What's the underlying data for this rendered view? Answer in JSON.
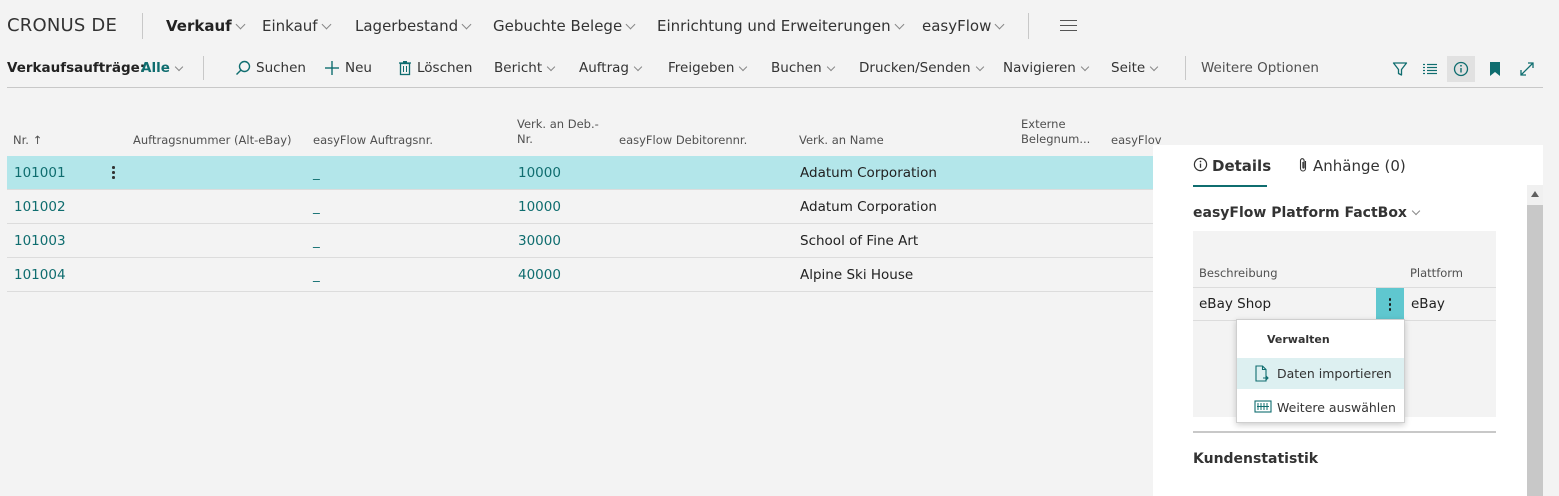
{
  "app": {
    "company": "CRONUS DE",
    "nav": [
      {
        "label": "Verkauf",
        "active": true
      },
      {
        "label": "Einkauf"
      },
      {
        "label": "Lagerbestand"
      },
      {
        "label": "Gebuchte Belege"
      },
      {
        "label": "Einrichtung und Erweiterungen"
      },
      {
        "label": "easyFlow"
      }
    ]
  },
  "actionbar": {
    "title": "Verkaufsaufträge:",
    "filter": "Alle",
    "search": "Suchen",
    "new": "Neu",
    "delete": "Löschen",
    "menus": [
      "Bericht",
      "Auftrag",
      "Freigeben",
      "Buchen",
      "Drucken/Senden",
      "Navigieren",
      "Seite"
    ],
    "more": "Weitere Optionen",
    "right_icons": [
      "filter-icon",
      "list-icon",
      "info-icon",
      "bookmark-icon",
      "expand-icon"
    ]
  },
  "table": {
    "headers": {
      "nr": "Nr. ↑",
      "auftragsnummer": "Auftragsnummer (Alt-eBay)",
      "ef_auftragsnr": "easyFlow Auftragsnr.",
      "deb_nr_1": "Verk. an Deb.-",
      "deb_nr_2": "Nr.",
      "ef_debitor": "easyFlow Debitorennr.",
      "name": "Verk. an Name",
      "ext_1": "Externe",
      "ext_2": "Belegnum...",
      "ef_trunc": "easyFlov"
    },
    "rows": [
      {
        "nr": "101001",
        "ef": "_",
        "deb": "10000",
        "name": "Adatum Corporation",
        "selected": true
      },
      {
        "nr": "101002",
        "ef": "_",
        "deb": "10000",
        "name": "Adatum Corporation"
      },
      {
        "nr": "101003",
        "ef": "_",
        "deb": "30000",
        "name": "School of Fine Art"
      },
      {
        "nr": "101004",
        "ef": "_",
        "deb": "40000",
        "name": "Alpine Ski House"
      }
    ]
  },
  "factbox": {
    "tab_details": "Details",
    "tab_attachments": "Anhänge (0)",
    "section_title": "easyFlow Platform FactBox",
    "col_desc": "Beschreibung",
    "col_platform": "Plattform",
    "row_desc": "eBay Shop",
    "row_platform": "eBay",
    "kunden": "Kundenstatistik"
  },
  "context_menu": {
    "header": "Verwalten",
    "items": [
      {
        "label": "Daten importieren",
        "icon": "import-document-icon",
        "highlighted": true
      },
      {
        "label": "Weitere auswählen",
        "icon": "select-more-icon"
      }
    ]
  },
  "colors": {
    "accent": "#0f6d6f",
    "selected_row": "#b3e6ea",
    "menu_highlight": "#ddf0f1",
    "dots_button": "#5fc7cf"
  }
}
